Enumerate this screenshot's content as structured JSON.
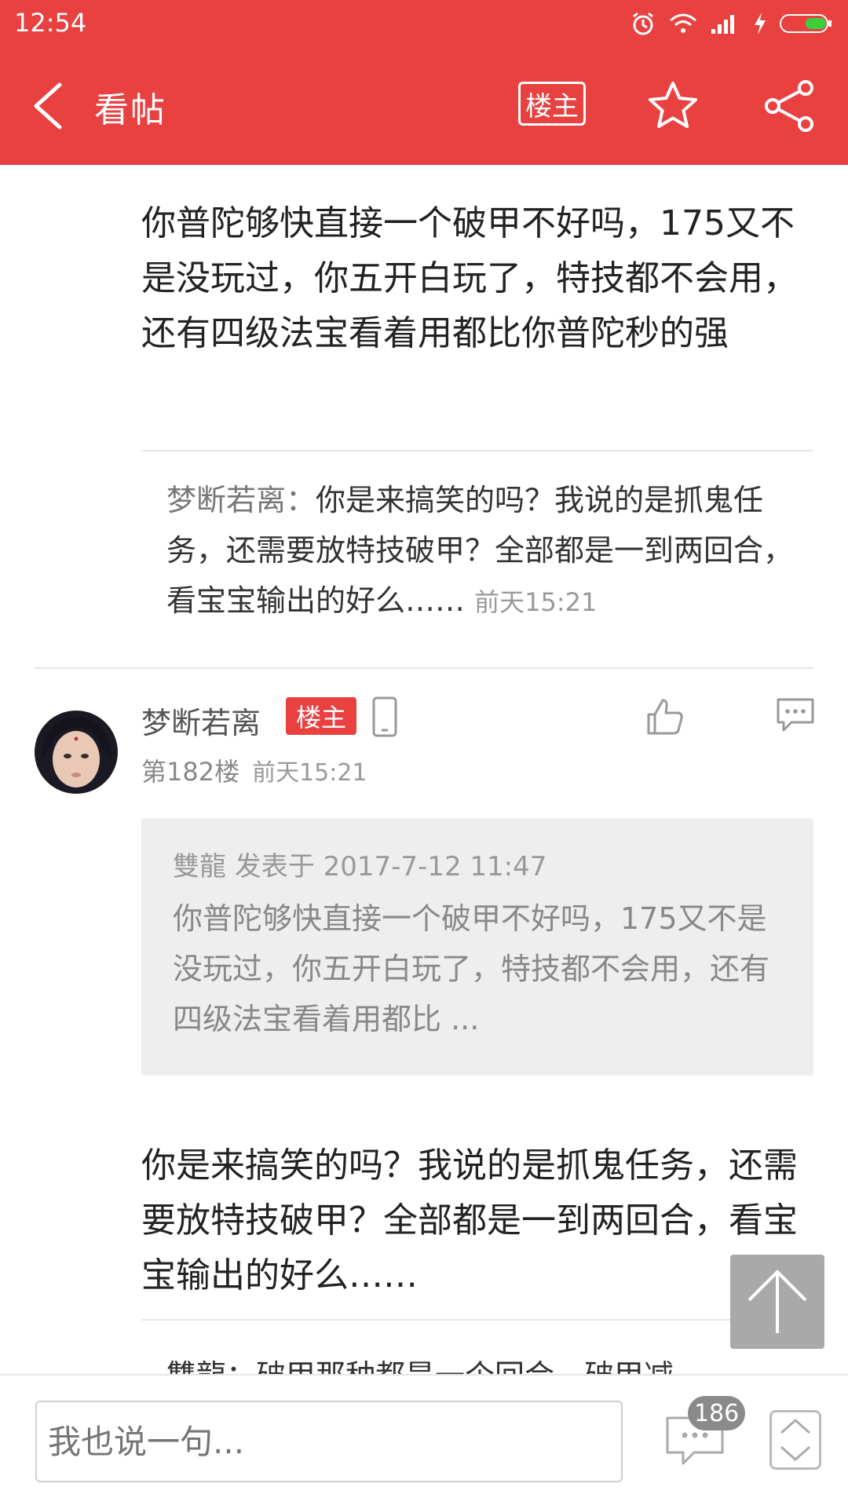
{
  "status_bar": {
    "time": "12:54"
  },
  "header": {
    "title": "看帖",
    "op_only_label": "楼主"
  },
  "prev_post": {
    "text": "你普陀够快直接一个破甲不好吗，175又不是没玩过，你五开白玩了，特技都不会用，还有四级法宝看着用都比你普陀秒的强",
    "sub_reply": {
      "author": "梦断若离：",
      "text": "你是来搞笑的吗？我说的是抓鬼任务，还需要放特技破甲？全部都是一到两回合，看宝宝输出的好么……",
      "time": "前天15:21"
    }
  },
  "post": {
    "author": "梦断若离",
    "badge": "楼主",
    "floor": "第182楼",
    "time": "前天15:21",
    "quote": {
      "header": "雙龍 发表于 2017-7-12 11:47",
      "text": "你普陀够快直接一个破甲不好吗，175又不是没玩过，你五开白玩了，特技都不会用，还有四级法宝看着用都比 ..."
    },
    "text": "你是来搞笑的吗？我说的是抓鬼任务，还需要放特技破甲？全部都是一到两回合，看宝宝输出的好么……",
    "sub_reply_partial": "雙龍：破甲那种都是一个回合，破甲减"
  },
  "bottom_bar": {
    "input_placeholder": "我也说一句...",
    "comment_count": "186"
  },
  "colors": {
    "brand": "#e94040",
    "badge_gray": "#8a8a8a",
    "quote_bg": "#eeeeee"
  },
  "icons": [
    "back-arrow-icon",
    "star-icon",
    "share-icon",
    "mobile-icon",
    "thumbs-up-icon",
    "comment-icon",
    "arrow-up-icon",
    "page-nav-icon"
  ]
}
